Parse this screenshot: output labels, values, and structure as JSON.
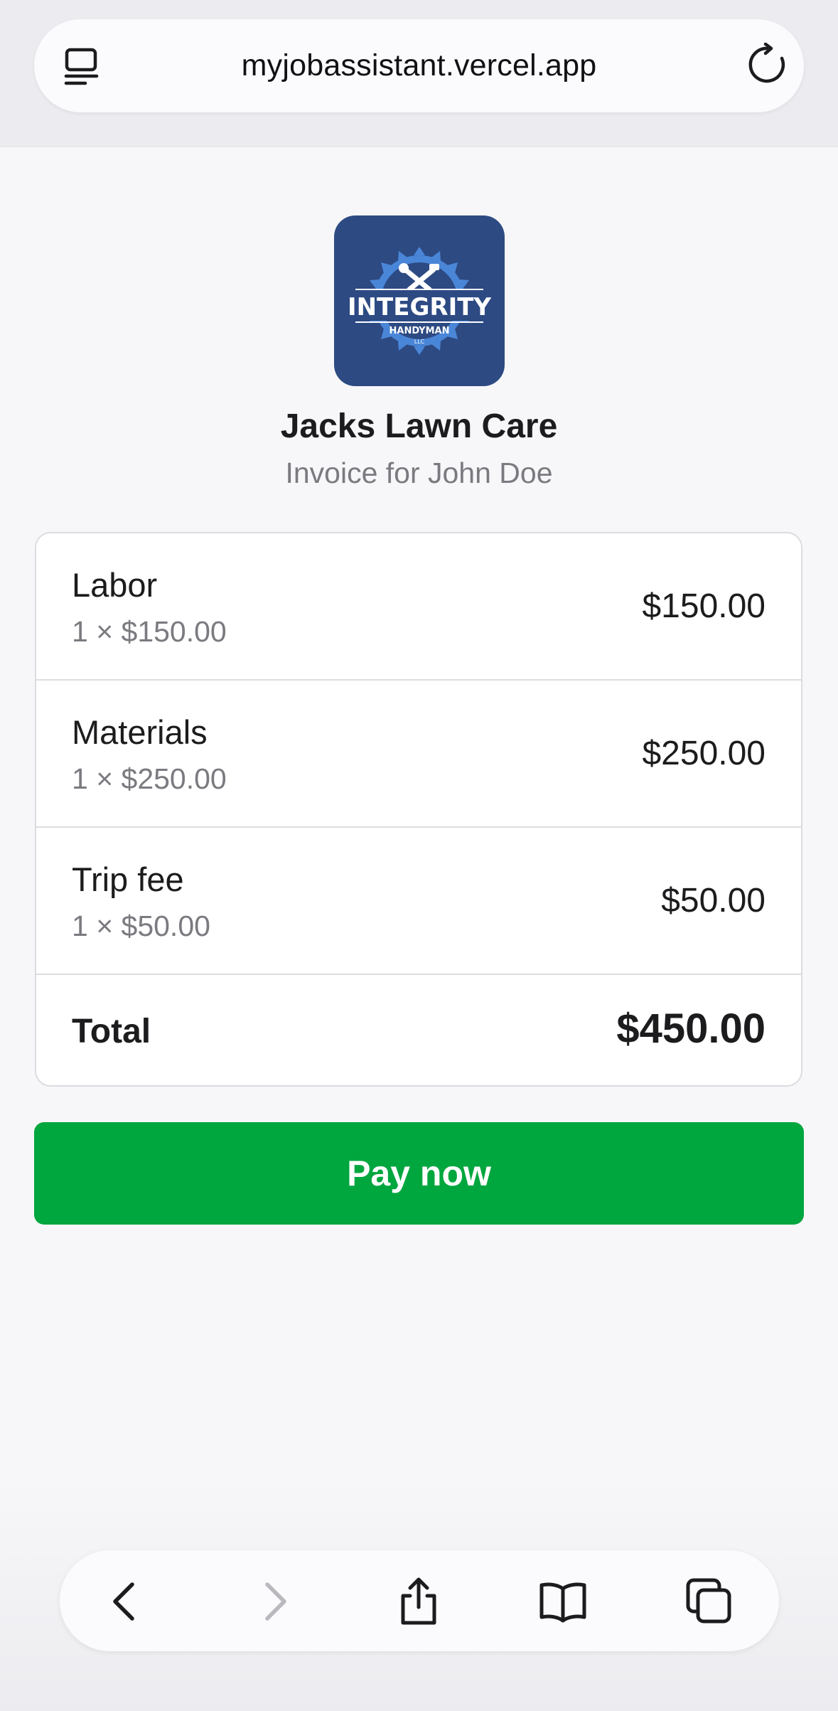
{
  "browser": {
    "url": "myjobassistant.vercel.app",
    "icons": {
      "page_settings": "page-settings-icon",
      "reload": "reload-icon"
    }
  },
  "business": {
    "logo": {
      "wordmark": "INTEGRITY",
      "subline": "HANDYMAN",
      "suffix": "LLC",
      "background_color": "#2d4a83"
    },
    "name": "Jacks Lawn Care",
    "invoice_for": "Invoice for John Doe"
  },
  "invoice": {
    "items": [
      {
        "name": "Labor",
        "detail": "1 × $150.00",
        "amount": "$150.00"
      },
      {
        "name": "Materials",
        "detail": "1 × $250.00",
        "amount": "$250.00"
      },
      {
        "name": "Trip fee",
        "detail": "1 × $50.00",
        "amount": "$50.00"
      }
    ],
    "total_label": "Total",
    "total_amount": "$450.00"
  },
  "pay_button": {
    "label": "Pay now",
    "color": "#00a63e"
  },
  "toolbar": {
    "icons": [
      "back-icon",
      "forward-icon",
      "share-icon",
      "bookmarks-icon",
      "tabs-icon"
    ]
  }
}
